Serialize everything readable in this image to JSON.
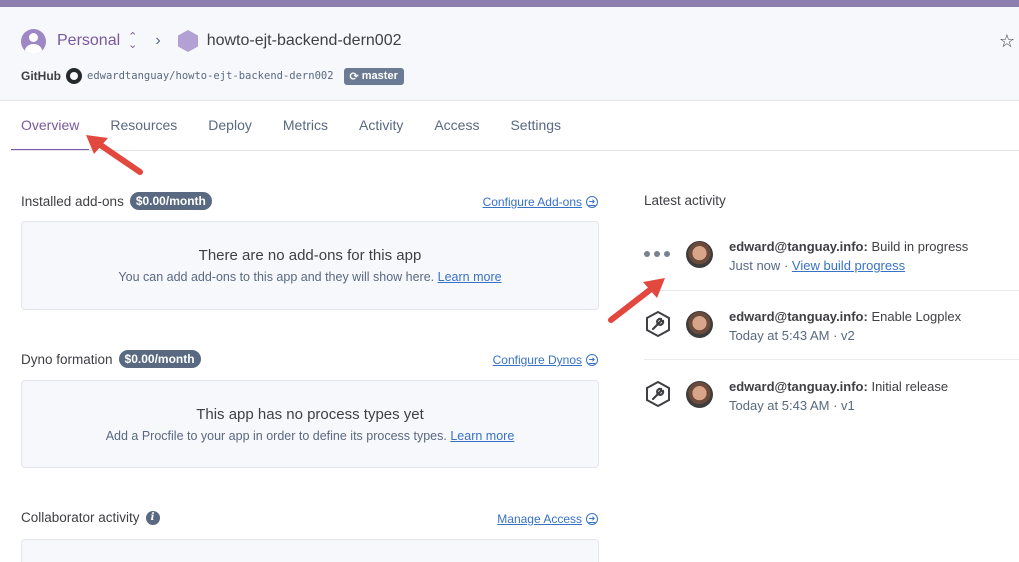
{
  "header": {
    "team": "Personal",
    "app_name": "howto-ejt-backend-dern002",
    "github_label": "GitHub",
    "repo": "edwardtanguay/howto-ejt-backend-dern002",
    "branch": "master"
  },
  "tabs": [
    "Overview",
    "Resources",
    "Deploy",
    "Metrics",
    "Activity",
    "Access",
    "Settings"
  ],
  "active_tab": "Overview",
  "addons": {
    "title": "Installed add-ons",
    "price": "$0.00/month",
    "link": "Configure Add-ons",
    "empty_title": "There are no add-ons for this app",
    "empty_text": "You can add add-ons to this app and they will show here.",
    "learn_more": "Learn more"
  },
  "dynos": {
    "title": "Dyno formation",
    "price": "$0.00/month",
    "link": "Configure Dynos",
    "empty_title": "This app has no process types yet",
    "empty_text": "Add a Procfile to your app in order to define its process types.",
    "learn_more": "Learn more"
  },
  "collaborators": {
    "title": "Collaborator activity",
    "link": "Manage Access"
  },
  "activity": {
    "title": "Latest activity",
    "items": [
      {
        "user": "edward@tanguay.info:",
        "action": "Build in progress",
        "time": "Just now",
        "separator": "·",
        "link": "View build progress",
        "version": "",
        "icon": "dots-icon"
      },
      {
        "user": "edward@tanguay.info:",
        "action": "Enable Logplex",
        "time": "Today at 5:43 AM",
        "separator": "·",
        "link": "",
        "version": "v2",
        "icon": "wrench-icon"
      },
      {
        "user": "edward@tanguay.info:",
        "action": "Initial release",
        "time": "Today at 5:43 AM",
        "separator": "·",
        "link": "",
        "version": "v1",
        "icon": "wrench-icon"
      }
    ]
  },
  "colors": {
    "accent": "#79589f",
    "link": "#3872c5",
    "annotation_arrow": "#e2483d"
  }
}
